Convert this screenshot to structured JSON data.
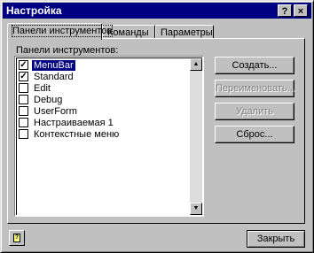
{
  "window": {
    "title": "Настройка"
  },
  "titlebar": {
    "help_label": "?",
    "close_label": "×"
  },
  "tabs": [
    {
      "label": "Панели инструментов",
      "active": true
    },
    {
      "label": "Команды",
      "active": false
    },
    {
      "label": "Параметры",
      "active": false
    }
  ],
  "toolbars_list": {
    "label": "Панели инструментов:",
    "items": [
      {
        "label": "MenuBar",
        "checked": true,
        "selected": true
      },
      {
        "label": "Standard",
        "checked": true,
        "selected": false
      },
      {
        "label": "Edit",
        "checked": false,
        "selected": false
      },
      {
        "label": "Debug",
        "checked": false,
        "selected": false
      },
      {
        "label": "UserForm",
        "checked": false,
        "selected": false
      },
      {
        "label": "Настраиваемая 1",
        "checked": false,
        "selected": false
      },
      {
        "label": "Контекстные меню",
        "checked": false,
        "selected": false
      }
    ]
  },
  "actions": {
    "create": "Создать...",
    "rename": "Переименовать...",
    "delete": "Удалить",
    "reset": "Сброс..."
  },
  "footer": {
    "close": "Закрыть"
  }
}
